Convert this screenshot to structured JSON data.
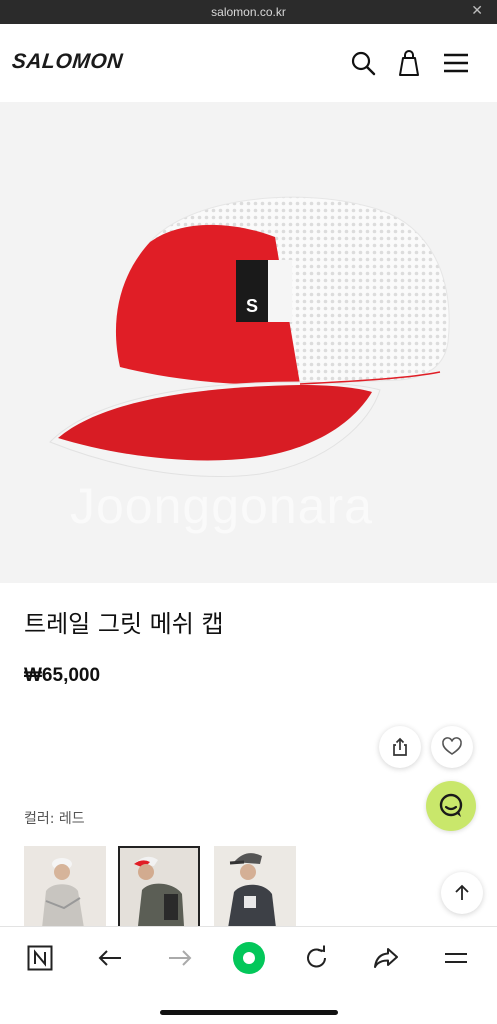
{
  "browser": {
    "url": "salomon.co.kr",
    "close_label": "✕"
  },
  "header": {
    "logo": "SALOMON",
    "icons": [
      "search-icon",
      "shopping-bag-icon",
      "menu-icon"
    ]
  },
  "hero": {
    "image": "red-white-mesh-cap",
    "watermark": "Joonggonara",
    "cap_logo": "S"
  },
  "product": {
    "title": "트레일 그릿 메쉬 캡",
    "price": "₩65,000",
    "color_label": "컬러: 레드"
  },
  "actions": [
    "share-icon",
    "heart-icon",
    "chat-icon",
    "scroll-top-icon"
  ],
  "thumbnails": [
    {
      "name": "model-white-cap",
      "selected": false
    },
    {
      "name": "model-red-cap",
      "selected": true
    },
    {
      "name": "model-gray-cap",
      "selected": false
    }
  ],
  "bottom_nav": [
    "naver-icon",
    "back-icon",
    "forward-icon",
    "green-dot-icon",
    "refresh-icon",
    "share-arrow-icon",
    "menu-lines-icon"
  ],
  "colors": {
    "accent_green": "#c9e76b",
    "cap_red": "#e01e26",
    "dot_green": "#03c75a"
  }
}
